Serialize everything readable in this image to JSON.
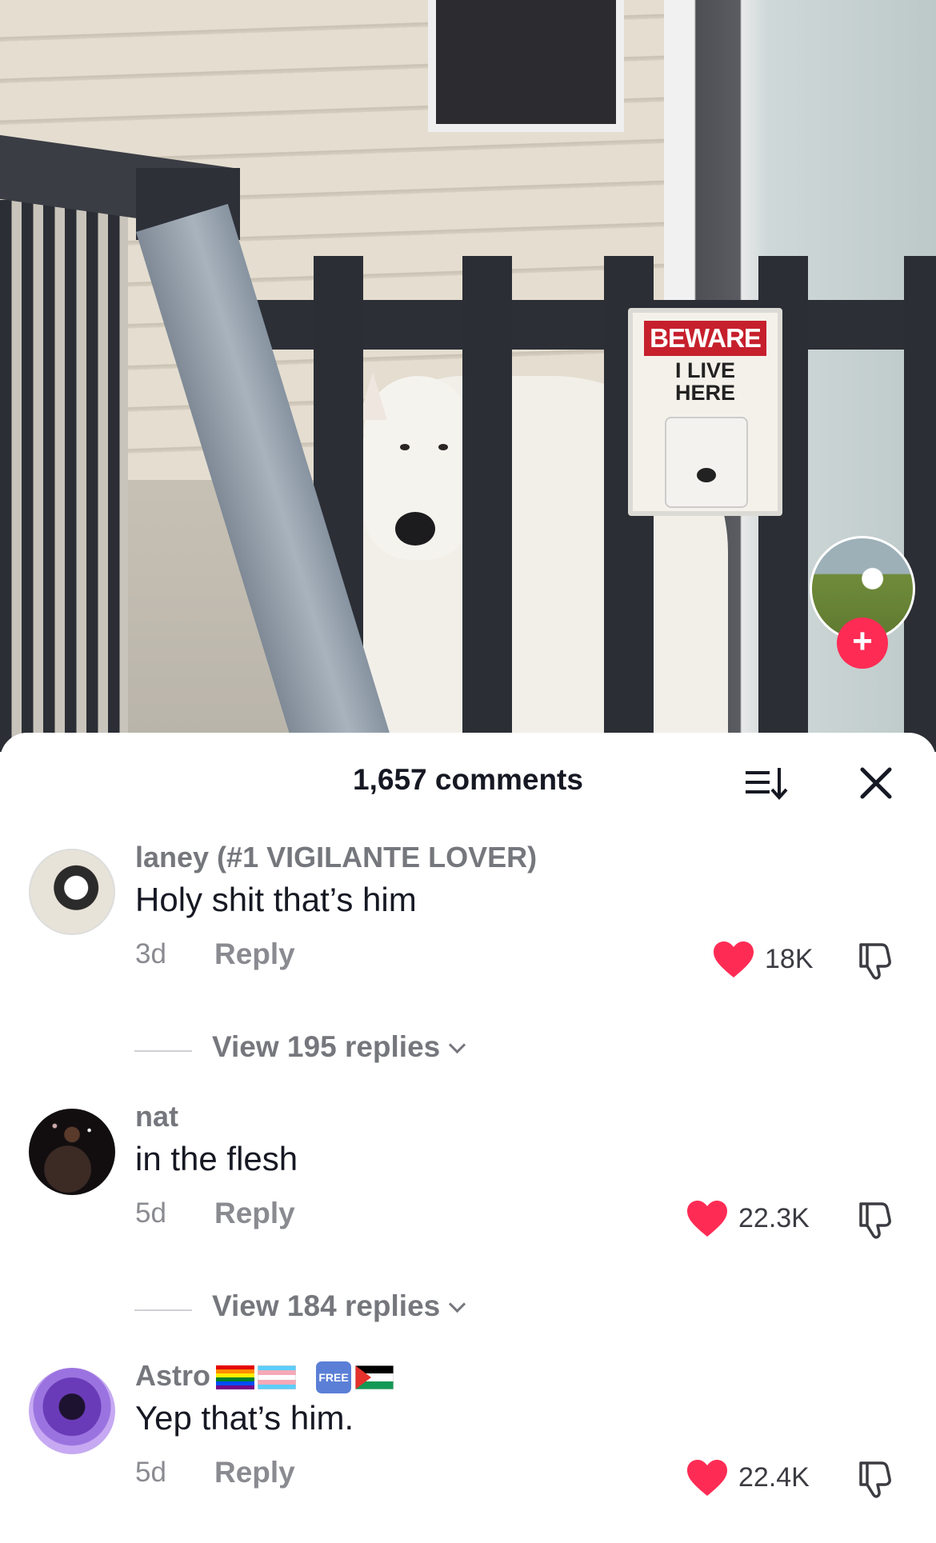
{
  "video": {
    "sign_title": "BEWARE",
    "sign_line1": "I LIVE",
    "sign_line2": "HERE",
    "follow_label": "+"
  },
  "comments_header": {
    "count_label": "1,657 comments",
    "sort_icon": "sort-icon",
    "close_icon": "close-icon"
  },
  "comments": [
    {
      "username": "laney (#1 VIGILANTE LOVER)",
      "text": "Holy shit that’s him",
      "age": "3d",
      "reply_label": "Reply",
      "likes": "18K",
      "liked": true,
      "view_replies": "View 195 replies"
    },
    {
      "username": "nat",
      "text": "in the flesh",
      "age": "5d",
      "reply_label": "Reply",
      "likes": "22.3K",
      "liked": true,
      "view_replies": "View 184 replies"
    },
    {
      "username": "Astro",
      "username_badges": [
        "rainbow-flag",
        "transgender-flag",
        "FREE",
        "palestine-flag"
      ],
      "free_label": "FREE",
      "text": "Yep that’s him.",
      "age": "5d",
      "reply_label": "Reply",
      "likes": "22.4K",
      "liked": true
    }
  ],
  "colors": {
    "accent": "#fe2c55",
    "text": "#161823",
    "muted": "#8a8b91"
  }
}
